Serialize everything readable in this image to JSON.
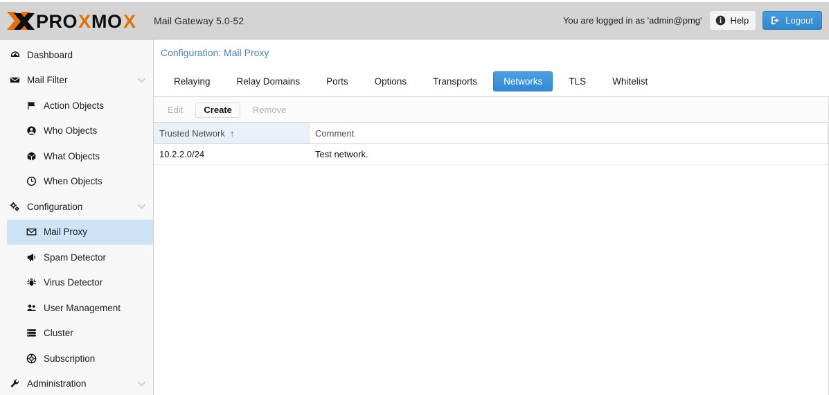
{
  "header": {
    "logo_text_parts": [
      "PROXMO",
      "X"
    ],
    "product_title": "Mail Gateway 5.0-52",
    "login_status": "You are logged in as 'admin@pmg'",
    "help_label": "Help",
    "logout_label": "Logout",
    "colors": {
      "brand_orange": "#e57000",
      "brand_black": "#000000",
      "bar_background": "#d4d4d4",
      "accent_blue": "#3892d4"
    }
  },
  "sidebar": {
    "items": [
      {
        "label": "Dashboard",
        "icon": "dashboard-icon",
        "level": 0,
        "selected": false,
        "expandable": false
      },
      {
        "label": "Mail Filter",
        "icon": "envelope-icon",
        "level": 0,
        "selected": false,
        "expandable": true
      },
      {
        "label": "Action Objects",
        "icon": "flag-icon",
        "level": 1,
        "selected": false,
        "expandable": false
      },
      {
        "label": "Who Objects",
        "icon": "user-circle-icon",
        "level": 1,
        "selected": false,
        "expandable": false
      },
      {
        "label": "What Objects",
        "icon": "cube-icon",
        "level": 1,
        "selected": false,
        "expandable": false
      },
      {
        "label": "When Objects",
        "icon": "clock-icon",
        "level": 1,
        "selected": false,
        "expandable": false
      },
      {
        "label": "Configuration",
        "icon": "gears-icon",
        "level": 0,
        "selected": false,
        "expandable": true
      },
      {
        "label": "Mail Proxy",
        "icon": "envelope-open-icon",
        "level": 1,
        "selected": true,
        "expandable": false
      },
      {
        "label": "Spam Detector",
        "icon": "bullhorn-icon",
        "level": 1,
        "selected": false,
        "expandable": false
      },
      {
        "label": "Virus Detector",
        "icon": "bug-icon",
        "level": 1,
        "selected": false,
        "expandable": false
      },
      {
        "label": "User Management",
        "icon": "users-icon",
        "level": 1,
        "selected": false,
        "expandable": false
      },
      {
        "label": "Cluster",
        "icon": "server-icon",
        "level": 1,
        "selected": false,
        "expandable": false
      },
      {
        "label": "Subscription",
        "icon": "life-ring-icon",
        "level": 1,
        "selected": false,
        "expandable": false
      },
      {
        "label": "Administration",
        "icon": "wrench-icon",
        "level": 0,
        "selected": false,
        "expandable": true
      }
    ],
    "selected_background": "#cfe3f6"
  },
  "main": {
    "title": "Configuration: Mail Proxy",
    "title_color": "#4e7ea8",
    "tabs": [
      {
        "label": "Relaying",
        "active": false
      },
      {
        "label": "Relay Domains",
        "active": false
      },
      {
        "label": "Ports",
        "active": false
      },
      {
        "label": "Options",
        "active": false
      },
      {
        "label": "Transports",
        "active": false
      },
      {
        "label": "Networks",
        "active": true
      },
      {
        "label": "TLS",
        "active": false
      },
      {
        "label": "Whitelist",
        "active": false
      }
    ],
    "toolbar": [
      {
        "label": "Edit",
        "enabled": false
      },
      {
        "label": "Create",
        "enabled": true
      },
      {
        "label": "Remove",
        "enabled": false
      }
    ],
    "grid": {
      "columns": [
        {
          "label": "Trusted Network",
          "sorted": true,
          "sort_direction": "ascending",
          "sort_glyph": "↑"
        },
        {
          "label": "Comment",
          "sorted": false,
          "sort_direction": "",
          "sort_glyph": ""
        }
      ],
      "rows": [
        {
          "trusted_network": "10.2.2.0/24",
          "comment": "Test network."
        }
      ]
    }
  }
}
